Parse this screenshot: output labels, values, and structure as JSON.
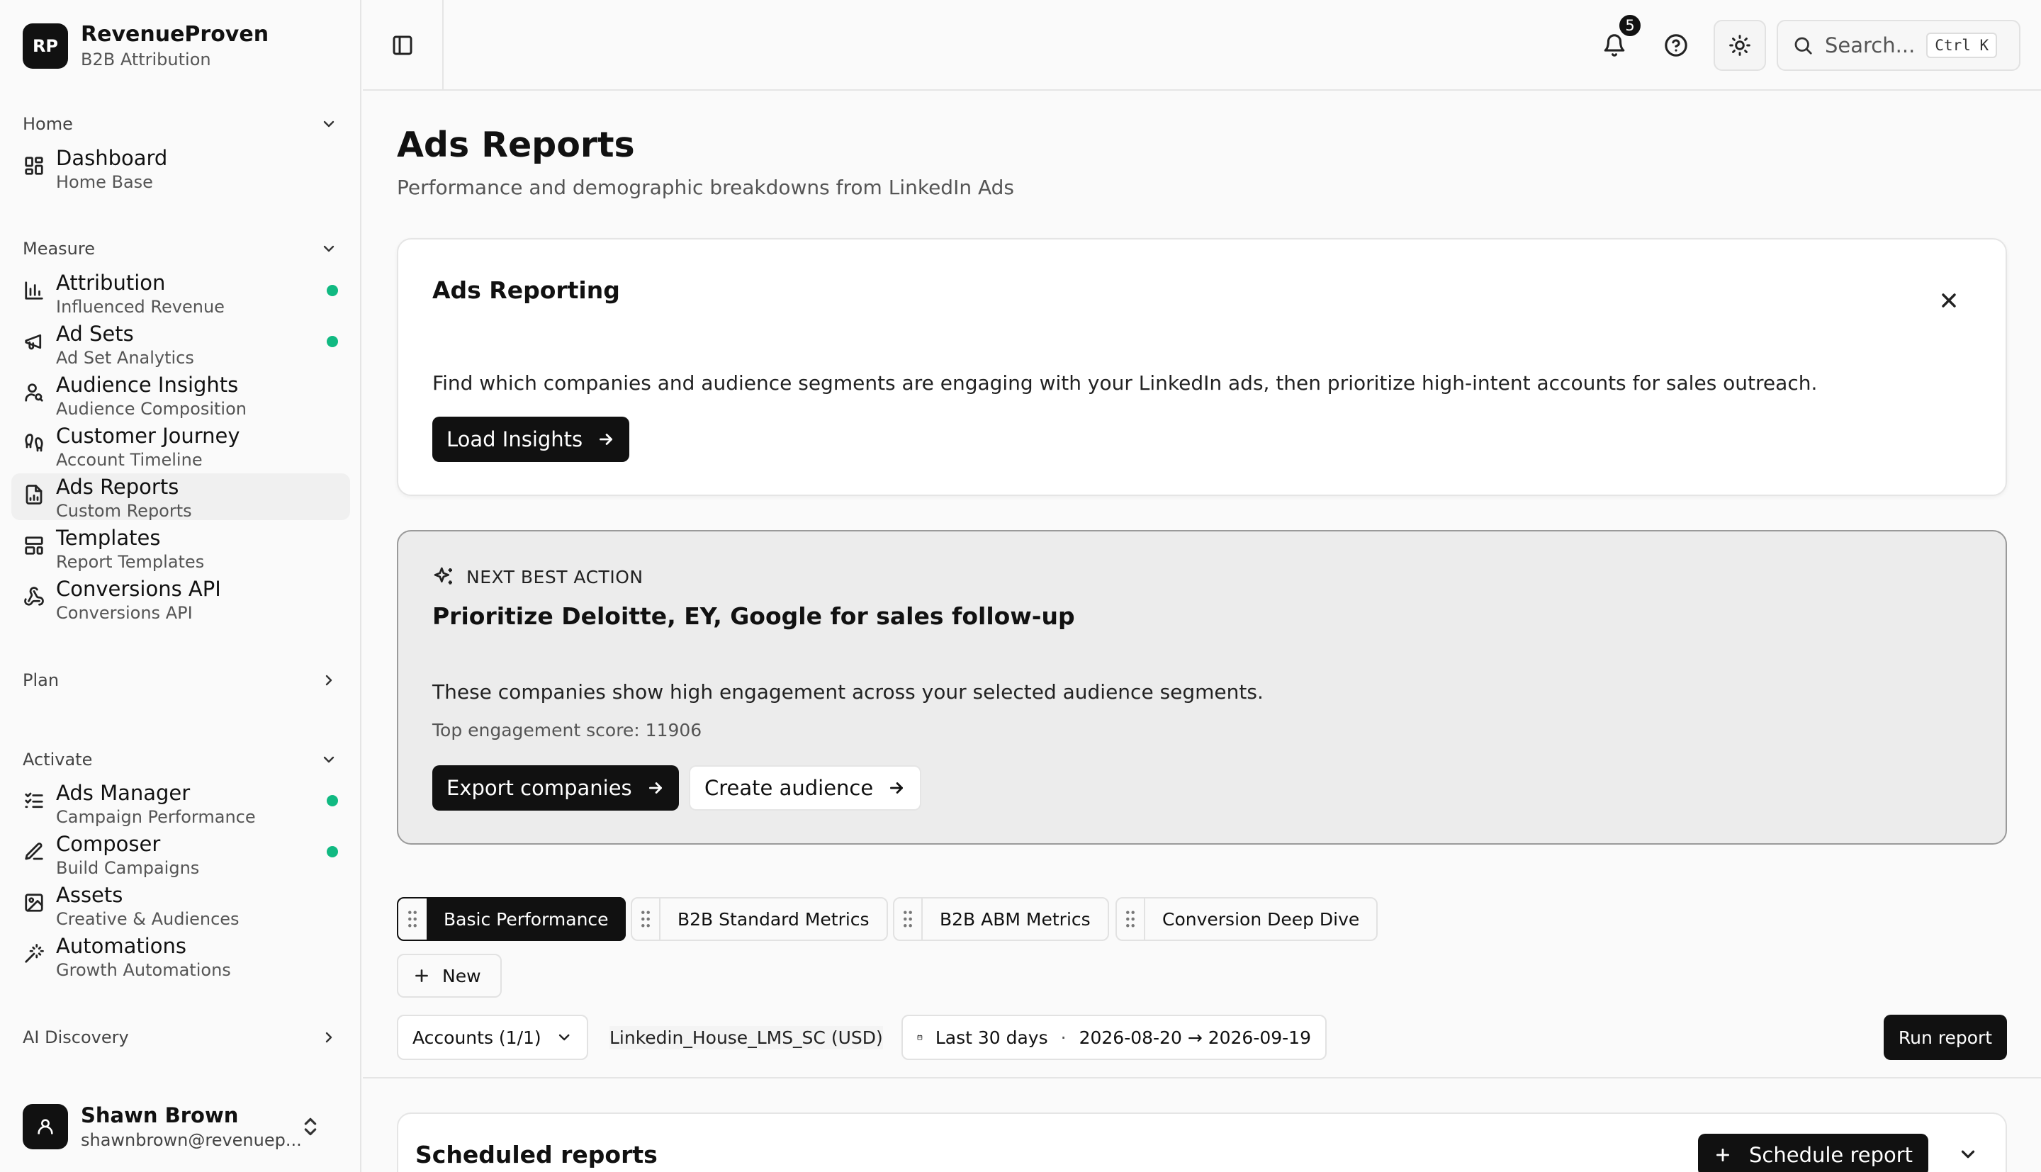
{
  "brand": {
    "logo": "RP",
    "name": "RevenueProven",
    "sub": "B2B Attribution"
  },
  "sidebar": {
    "sections": {
      "home": "Home",
      "measure": "Measure",
      "plan": "Plan",
      "activate": "Activate",
      "ai": "AI Discovery"
    },
    "items": [
      {
        "label": "Dashboard",
        "sub": "Home Base",
        "icon": "grid-icon"
      },
      {
        "label": "Attribution",
        "sub": "Influenced Revenue",
        "icon": "bar-chart-icon",
        "status": "active"
      },
      {
        "label": "Ad Sets",
        "sub": "Ad Set Analytics",
        "icon": "megaphone-icon",
        "status": "active"
      },
      {
        "label": "Audience Insights",
        "sub": "Audience Composition",
        "icon": "user-search-icon"
      },
      {
        "label": "Customer Journey",
        "sub": "Account Timeline",
        "icon": "footprints-icon"
      },
      {
        "label": "Ads Reports",
        "sub": "Custom Reports",
        "icon": "file-chart-icon"
      },
      {
        "label": "Templates",
        "sub": "Report Templates",
        "icon": "layout-icon"
      },
      {
        "label": "Conversions API",
        "sub": "Conversions API",
        "icon": "webhook-icon"
      },
      {
        "label": "Ads Manager",
        "sub": "Campaign Performance",
        "icon": "list-check-icon",
        "status": "active"
      },
      {
        "label": "Composer",
        "sub": "Build Campaigns",
        "icon": "pen-icon",
        "status": "active"
      },
      {
        "label": "Assets",
        "sub": "Creative & Audiences",
        "icon": "image-icon"
      },
      {
        "label": "Automations",
        "sub": "Growth Automations",
        "icon": "wand-icon"
      }
    ],
    "active_item": "Ads Reports",
    "status_color": "#10b981"
  },
  "user": {
    "name": "Shawn Brown",
    "email": "shawnbrown@revenuep..."
  },
  "topbar": {
    "notifications": "5",
    "search_placeholder": "Search...",
    "shortcut": "Ctrl K"
  },
  "page": {
    "title": "Ads Reports",
    "subtitle": "Performance and demographic breakdowns from LinkedIn Ads"
  },
  "insights_card": {
    "title": "Ads Reporting",
    "description": "Find which companies and audience segments are engaging with your LinkedIn ads, then prioritize high-intent accounts for sales outreach.",
    "button": "Load Insights"
  },
  "next_best_action": {
    "label": "NEXT BEST ACTION",
    "title": "Prioritize Deloitte, EY, Google for sales follow-up",
    "description": "These companies show high engagement across your selected audience segments.",
    "score": "Top engagement score: 11906",
    "primary_button": "Export companies",
    "secondary_button": "Create audience"
  },
  "tabs": [
    "Basic Performance",
    "B2B Standard Metrics",
    "B2B ABM Metrics",
    "Conversion Deep Dive"
  ],
  "new_label": "New",
  "filters": {
    "accounts": "Accounts (1/1)",
    "account_name": "Linkedin_House_LMS_SC (USD)",
    "date_range": "Last 30 days",
    "separator": "·",
    "dates": "2026-08-20 → 2026-09-19",
    "run": "Run report"
  },
  "scheduled": {
    "title": "Scheduled reports",
    "button": "Schedule report"
  }
}
